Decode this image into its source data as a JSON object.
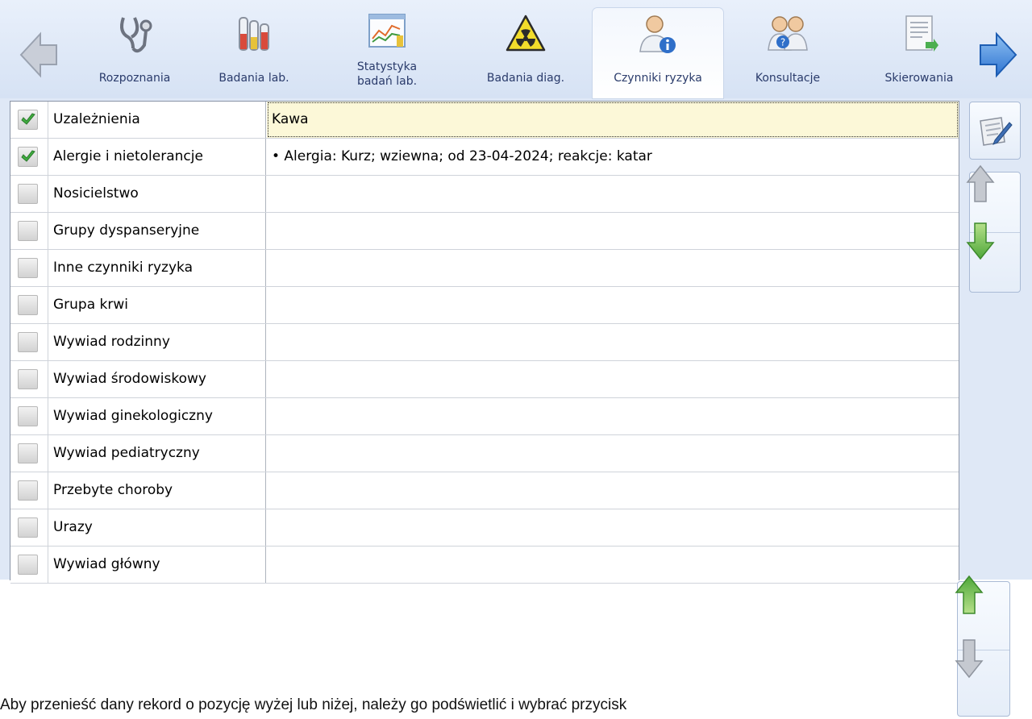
{
  "tabs": [
    {
      "label": "Rozpoznania",
      "icon": "stethoscope-icon",
      "active": false
    },
    {
      "label": "Badania lab.",
      "icon": "lab-tubes-icon",
      "active": false
    },
    {
      "label": "Statystyka\nbadań lab.",
      "icon": "chart-icon",
      "active": false
    },
    {
      "label": "Badania diag.",
      "icon": "radiation-icon",
      "active": false
    },
    {
      "label": "Czynniki ryzyka",
      "icon": "person-info-icon",
      "active": true
    },
    {
      "label": "Konsultacje",
      "icon": "doctors-icon",
      "active": false
    },
    {
      "label": "Skierowania",
      "icon": "document-icon",
      "active": false
    }
  ],
  "rows": [
    {
      "name": "Uzależnienia",
      "value": "Kawa",
      "checked": true
    },
    {
      "name": "Alergie i nietolerancje",
      "value": "• Alergia: Kurz; wziewna; od 23-04-2024; reakcje: katar",
      "checked": true
    },
    {
      "name": "Nosicielstwo",
      "value": "",
      "checked": false
    },
    {
      "name": "Grupy dyspanseryjne",
      "value": "",
      "checked": false
    },
    {
      "name": "Inne czynniki ryzyka",
      "value": "",
      "checked": false
    },
    {
      "name": "Grupa krwi",
      "value": "",
      "checked": false
    },
    {
      "name": "Wywiad rodzinny",
      "value": "",
      "checked": false
    },
    {
      "name": "Wywiad środowiskowy",
      "value": "",
      "checked": false
    },
    {
      "name": "Wywiad ginekologiczny",
      "value": "",
      "checked": false
    },
    {
      "name": "Wywiad pediatryczny",
      "value": "",
      "checked": false
    },
    {
      "name": "Przebyte choroby",
      "value": "",
      "checked": false
    },
    {
      "name": "Urazy",
      "value": "",
      "checked": false
    },
    {
      "name": "Wywiad główny",
      "value": "",
      "checked": false
    }
  ],
  "document": {
    "text": "Aby przenieść dany rekord o pozycję wyżej lub niżej, należy go podświetlić i wybrać przycisk"
  },
  "colors": {
    "accent": "#3f7fd8",
    "selected_row": "#fcf8d8",
    "check_green": "#3fae3f"
  }
}
